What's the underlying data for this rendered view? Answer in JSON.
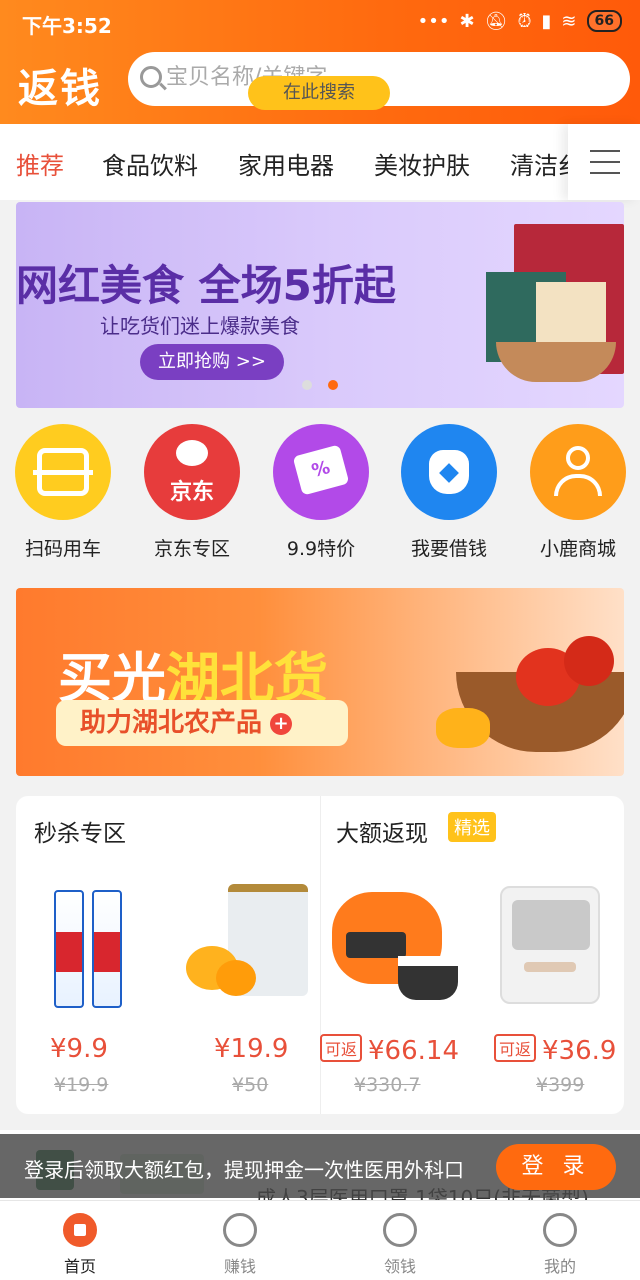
{
  "status_bar": {
    "time": "下午3:52",
    "icons": [
      "dots-icon",
      "bluetooth-icon",
      "mute-icon",
      "alarm-icon",
      "signal-icon",
      "wifi-icon"
    ],
    "battery": "66"
  },
  "header": {
    "logo": "返钱",
    "search": {
      "placeholder": "宝贝名称/关键字",
      "button": "在此搜索"
    },
    "accent": "#ff6a0f"
  },
  "tabs": {
    "items": [
      "推荐",
      "食品饮料",
      "家用电器",
      "美妆护肤",
      "清洁纟"
    ],
    "active": 0
  },
  "banner_top": {
    "title": "网红美食 全场5折起",
    "subtitle": "让吃货们迷上爆款美食",
    "cta": "立即抢购 >>",
    "active_dot": 1
  },
  "quick_links": [
    {
      "label": "扫码用车",
      "icon": "scan-icon"
    },
    {
      "label": "京东专区",
      "icon": "jd-icon",
      "icon_text": "京东"
    },
    {
      "label": "9.9特价",
      "icon": "coupon-icon",
      "icon_text": "%"
    },
    {
      "label": "我要借钱",
      "icon": "money-bag-icon"
    },
    {
      "label": "小鹿商城",
      "icon": "user-icon"
    }
  ],
  "banner_mid": {
    "title_a": "买光",
    "title_b": "湖北货",
    "subtitle": "助力湖北农产品"
  },
  "sections": {
    "flash": {
      "title": "秒杀专区",
      "products": [
        {
          "price": "¥9.9",
          "old_price": "¥19.9"
        },
        {
          "price": "¥19.9",
          "old_price": "¥50"
        }
      ]
    },
    "cashback": {
      "title": "大额返现",
      "badge": "精选",
      "tag": "可返",
      "products": [
        {
          "price": "¥66.14",
          "old_price": "¥330.7"
        },
        {
          "price": "¥36.9",
          "old_price": "¥399"
        }
      ]
    }
  },
  "peek_product": {
    "line2": "成人3层医用口罩 1袋10只(非无菌型)"
  },
  "toast": {
    "message": "登录后领取大额红包，提现押金一次性医用外科口",
    "button": "登 录"
  },
  "bottom_nav": [
    {
      "label": "首页",
      "icon": "home-icon",
      "active": true
    },
    {
      "label": "赚钱",
      "icon": "money-bag-icon",
      "active": false
    },
    {
      "label": "领钱",
      "icon": "coin-icon",
      "active": false
    },
    {
      "label": "我的",
      "icon": "profile-icon",
      "active": false
    }
  ]
}
